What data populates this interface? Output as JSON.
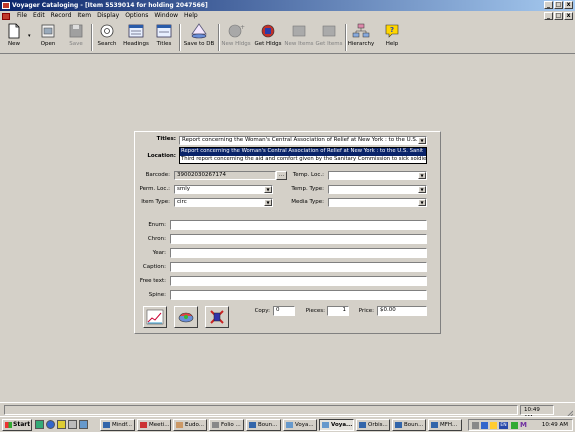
{
  "window": {
    "title": "Voyager Cataloging - [Item 5539014 for holding 2047566]",
    "minimize": "_",
    "restore": "□",
    "close": "x"
  },
  "menu": [
    "File",
    "Edit",
    "Record",
    "Item",
    "Display",
    "Options",
    "Window",
    "Help"
  ],
  "toolbar": {
    "new": "New",
    "open": "Open",
    "save": "Save",
    "search": "Search",
    "headings": "Headings",
    "titles": "Titles",
    "save_to_db": "Save to DB",
    "new_hldgs": "New Hldgs",
    "get_hldgs": "Get Hldgs",
    "new_items": "New Items",
    "get_items": "Get Items",
    "hierarchy": "Hierarchy",
    "help": "Help"
  },
  "form": {
    "titles_label": "Titles:",
    "titles_value": "Report concerning the Woman's Central Association of Relief at New York : to the U.S. Sa",
    "titles_options": [
      "Report concerning the Woman's Central Association of Relief at New York : to the U.S. Sanit",
      "Third report concerning the aid and comfort given by the Sanitary Commission to sick soldiers"
    ],
    "location_label": "Location:",
    "barcode_label": "Barcode:",
    "barcode_value": "39002030267174",
    "barcode_btn": "...",
    "perm_loc_label": "Perm. Loc.:",
    "perm_loc_value": "smly",
    "item_type_label": "Item Type:",
    "item_type_value": "circ",
    "temp_loc_label": "Temp. Loc.:",
    "temp_type_label": "Temp. Type:",
    "media_type_label": "Media Type:",
    "enum_label": "Enum:",
    "chron_label": "Chron:",
    "year_label": "Year:",
    "caption_label": "Caption:",
    "free_text_label": "Free text:",
    "spine_label": "Spine:",
    "copy_label": "Copy:",
    "copy_value": "0",
    "pieces_label": "Pieces:",
    "pieces_value": "1",
    "price_label": "Price:",
    "price_value": "$0.00"
  },
  "status": {
    "time": "10:49 AM"
  },
  "taskbar": {
    "start": "Start",
    "tasks": [
      "Mindf...",
      "Meeti...",
      "Eudo...",
      "Folio ...",
      "Boun...",
      "Voya...",
      "Voya...",
      "Orbis...",
      "Boun...",
      "MFH..."
    ],
    "active_index": 6,
    "tray_lang": "EN",
    "clock": "10:49 AM"
  },
  "colors": {
    "titlebar_start": "#0a246a",
    "titlebar_end": "#a6caf0",
    "selection": "#0a246a",
    "face": "#d4d0c8"
  }
}
